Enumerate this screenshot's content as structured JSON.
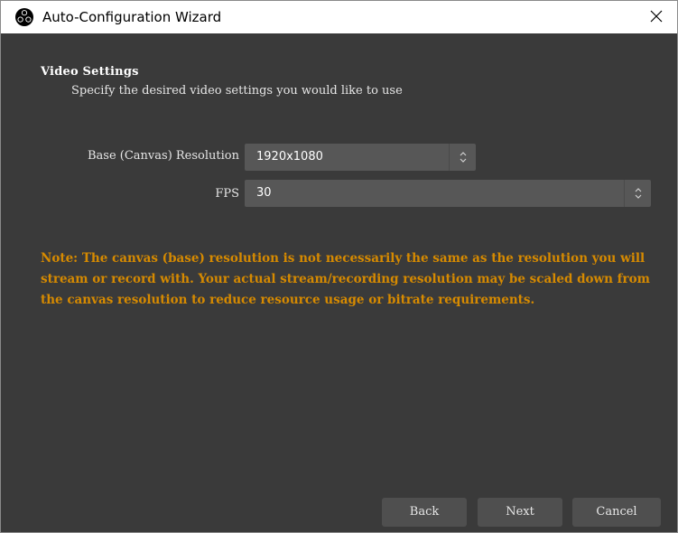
{
  "window": {
    "title": "Auto-Configuration Wizard",
    "app_icon": "obs-logo-icon",
    "close_icon": "close-icon"
  },
  "page": {
    "heading": "Video Settings",
    "subheading": "Specify the desired video settings you would like to use"
  },
  "form": {
    "base_resolution": {
      "label": "Base (Canvas) Resolution",
      "value": "1920x1080"
    },
    "fps": {
      "label": "FPS",
      "value": "30"
    }
  },
  "note": "Note: The canvas (base) resolution is not necessarily the same as the resolution you will stream or record with. Your actual stream/recording resolution may be scaled down from the canvas resolution to reduce resource usage or bitrate requirements.",
  "buttons": {
    "back": "Back",
    "next": "Next",
    "cancel": "Cancel"
  },
  "colors": {
    "background": "#3a3a3a",
    "input": "#575757",
    "button": "#4f4f4f",
    "note": "#d68a00",
    "titlebar": "#ffffff"
  }
}
